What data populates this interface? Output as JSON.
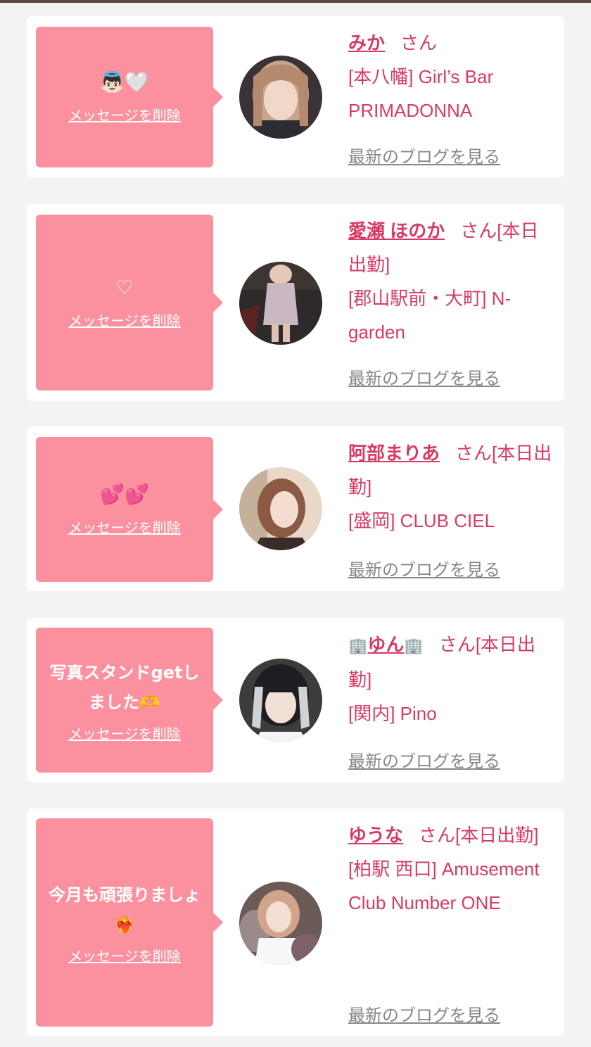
{
  "common": {
    "delete_label": "メッセージを削除",
    "blog_label": "最新のブログを見る",
    "honorific": "さん",
    "working_suffix": "[本日出勤]"
  },
  "colors": {
    "bubble": "#fb919e",
    "accent": "#d83a63",
    "link_gray": "#888888"
  },
  "cards": [
    {
      "message": "👼🏻🤍",
      "name": "みか",
      "honorific": "さん",
      "shop": "[本八幡] Girl’s Bar PRIMADONNA"
    },
    {
      "message": "♡",
      "name": "愛瀬 ほのか",
      "honorific": "さん[本日出勤]",
      "shop": "[郡山駅前・大町] N-garden"
    },
    {
      "message": "💕💕",
      "name": "阿部まりあ",
      "honorific": "さん[本日出勤]",
      "shop": "[盛岡] CLUB CIEL"
    },
    {
      "message": "写真スタンドgetしました🫶",
      "name_prefix_icon": "building-icon",
      "name": "ゆん",
      "name_suffix_icon": "building-icon",
      "honorific": "さん[本日出勤]",
      "shop": "[関内] Pino"
    },
    {
      "message": "今月も頑張りましょ❤️‍🔥",
      "name": "ゆうな",
      "honorific": "さん[本日出勤]",
      "shop": "[柏駅 西口] Amusement Club Number ONE"
    }
  ]
}
